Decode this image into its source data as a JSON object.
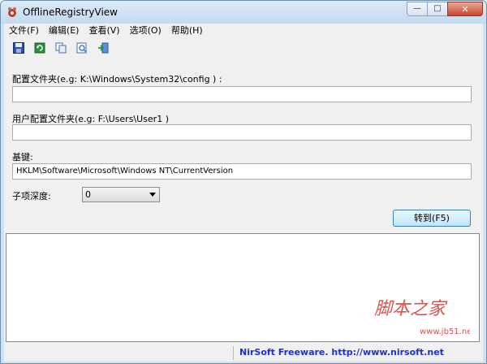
{
  "window": {
    "title": "OfflineRegistryView"
  },
  "menu": [
    "文件(F)",
    "编辑(E)",
    "查看(V)",
    "选项(O)",
    "帮助(H)"
  ],
  "toolbar": [
    {
      "icon": "save-icon"
    },
    {
      "icon": "refresh-icon"
    },
    {
      "icon": "copy-icon"
    },
    {
      "icon": "properties-icon"
    },
    {
      "icon": "exit-icon"
    }
  ],
  "form": {
    "config_folder_label": "配置文件夹(e.g: K:\\Windows\\System32\\config ) :",
    "config_folder_value": "",
    "user_profile_label": "用户配置文件夹(e.g: F:\\Users\\User1 )",
    "user_profile_value": "",
    "base_key_label": "基键:",
    "base_key_value": "HKLM\\Software\\Microsoft\\Windows NT\\CurrentVersion",
    "subkey_depth_label": "子项深度:",
    "subkey_depth_value": "0",
    "goto_button": "转到(F5)"
  },
  "status": {
    "link_text": "NirSoft Freeware.  http://www.nirsoft.net"
  },
  "watermark": {
    "text": "脚本之家",
    "url": "www.jb51.net"
  },
  "colors": {
    "link": "#1a2fd8",
    "watermark": "#d9534f",
    "close_button": "#c9462b"
  }
}
